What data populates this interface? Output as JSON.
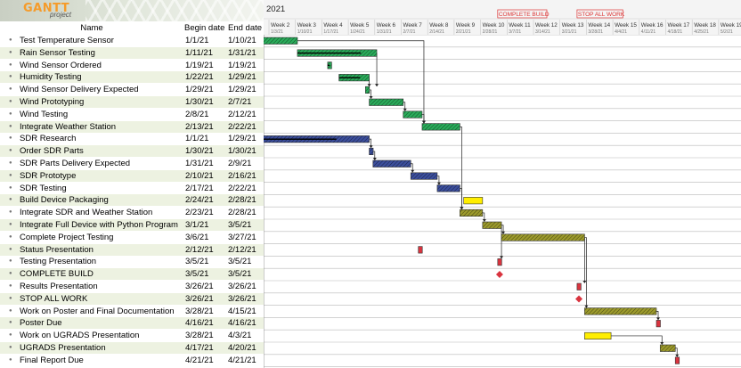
{
  "app": {
    "logo_text": "GANTT",
    "logo_sub": "project"
  },
  "columns": {
    "name": "Name",
    "begin": "Begin date",
    "end": "End date"
  },
  "year": "2021",
  "markers": [
    "COMPLETE BUILD",
    "STOP ALL WORK"
  ],
  "weeks": [
    {
      "label": "Week 2",
      "date": "1/3/21"
    },
    {
      "label": "Week 3",
      "date": "1/10/21"
    },
    {
      "label": "Week 4",
      "date": "1/17/21"
    },
    {
      "label": "Week 5",
      "date": "1/24/21"
    },
    {
      "label": "Week 6",
      "date": "1/31/21"
    },
    {
      "label": "Week 7",
      "date": "2/7/21"
    },
    {
      "label": "Week 8",
      "date": "2/14/21"
    },
    {
      "label": "Week 9",
      "date": "2/21/21"
    },
    {
      "label": "Week 10",
      "date": "2/28/21"
    },
    {
      "label": "Week 11",
      "date": "3/7/21"
    },
    {
      "label": "Week 12",
      "date": "3/14/21"
    },
    {
      "label": "Week 13",
      "date": "3/21/21"
    },
    {
      "label": "Week 14",
      "date": "3/28/21"
    },
    {
      "label": "Week 15",
      "date": "4/4/21"
    },
    {
      "label": "Week 16",
      "date": "4/11/21"
    },
    {
      "label": "Week 17",
      "date": "4/18/21"
    },
    {
      "label": "Week 18",
      "date": "4/25/21"
    },
    {
      "label": "Week 19",
      "date": "5/2/21"
    }
  ],
  "colors": {
    "green": "#2aab5a",
    "blue": "#3b4e9c",
    "olive": "#9c9a2c",
    "yellow": "#ffee00",
    "red": "#d9343f",
    "grid": "#b8b8b8"
  },
  "tasks": [
    {
      "name": "Test Temperature Sensor",
      "begin": "1/1/21",
      "end": "1/10/21",
      "color": "green",
      "type": "task",
      "progress": 1
    },
    {
      "name": "Rain Sensor Testing",
      "begin": "1/11/21",
      "end": "1/31/21",
      "color": "green",
      "type": "task",
      "progress": 0.8
    },
    {
      "name": "Wind Sensor Ordered",
      "begin": "1/19/21",
      "end": "1/19/21",
      "color": "green",
      "type": "task",
      "progress": 0.5
    },
    {
      "name": "Humidity Testing",
      "begin": "1/22/21",
      "end": "1/29/21",
      "color": "green",
      "type": "task",
      "progress": 0.7
    },
    {
      "name": "Wind Sensor Delivery Expected",
      "begin": "1/29/21",
      "end": "1/29/21",
      "color": "green",
      "type": "task",
      "progress": 1
    },
    {
      "name": "Wind Prototyping",
      "begin": "1/30/21",
      "end": "2/7/21",
      "color": "green",
      "type": "task",
      "progress": 1
    },
    {
      "name": "Wind Testing",
      "begin": "2/8/21",
      "end": "2/12/21",
      "color": "green",
      "type": "task",
      "progress": 1
    },
    {
      "name": "Integrate Weather Station",
      "begin": "2/13/21",
      "end": "2/22/21",
      "color": "green",
      "type": "task",
      "progress": 1
    },
    {
      "name": "SDR Research",
      "begin": "1/1/21",
      "end": "1/29/21",
      "color": "blue",
      "type": "task",
      "progress": 0.7
    },
    {
      "name": "Order SDR Parts",
      "begin": "1/30/21",
      "end": "1/30/21",
      "color": "blue",
      "type": "task",
      "progress": 1
    },
    {
      "name": "SDR Parts Delivery Expected",
      "begin": "1/31/21",
      "end": "2/9/21",
      "color": "blue",
      "type": "task",
      "progress": 1
    },
    {
      "name": "SDR Prototype",
      "begin": "2/10/21",
      "end": "2/16/21",
      "color": "blue",
      "type": "task",
      "progress": 1
    },
    {
      "name": "SDR Testing",
      "begin": "2/17/21",
      "end": "2/22/21",
      "color": "blue",
      "type": "task",
      "progress": 1
    },
    {
      "name": "Build Device Packaging",
      "begin": "2/24/21",
      "end": "2/28/21",
      "color": "yellow",
      "type": "task",
      "progress": 0
    },
    {
      "name": "Integrate SDR and Weather Station",
      "begin": "2/23/21",
      "end": "2/28/21",
      "color": "olive",
      "type": "task",
      "progress": 1
    },
    {
      "name": "Integrate Full Device with Python Program",
      "begin": "3/1/21",
      "end": "3/5/21",
      "color": "olive",
      "type": "task",
      "progress": 1
    },
    {
      "name": "Complete Project Testing",
      "begin": "3/6/21",
      "end": "3/27/21",
      "color": "olive",
      "type": "task",
      "progress": 1
    },
    {
      "name": "Status Presentation",
      "begin": "2/12/21",
      "end": "2/12/21",
      "color": "red",
      "type": "task",
      "progress": 1
    },
    {
      "name": "Testing Presentation",
      "begin": "3/5/21",
      "end": "3/5/21",
      "color": "red",
      "type": "task",
      "progress": 1
    },
    {
      "name": "COMPLETE BUILD",
      "begin": "3/5/21",
      "end": "3/5/21",
      "color": "red",
      "type": "milestone",
      "progress": 1
    },
    {
      "name": "Results Presentation",
      "begin": "3/26/21",
      "end": "3/26/21",
      "color": "red",
      "type": "task",
      "progress": 1
    },
    {
      "name": "STOP ALL WORK",
      "begin": "3/26/21",
      "end": "3/26/21",
      "color": "red",
      "type": "milestone",
      "progress": 1
    },
    {
      "name": "Work on Poster and Final Documentation",
      "begin": "3/28/21",
      "end": "4/15/21",
      "color": "olive",
      "type": "task",
      "progress": 1
    },
    {
      "name": "Poster Due",
      "begin": "4/16/21",
      "end": "4/16/21",
      "color": "red",
      "type": "task",
      "progress": 1
    },
    {
      "name": "Work on UGRADS Presentation",
      "begin": "3/28/21",
      "end": "4/3/21",
      "color": "yellow",
      "type": "task",
      "progress": 0
    },
    {
      "name": "UGRADS Presentation",
      "begin": "4/17/21",
      "end": "4/20/21",
      "color": "olive",
      "type": "task",
      "progress": 1
    },
    {
      "name": "Final Report Due",
      "begin": "4/21/21",
      "end": "4/21/21",
      "color": "red",
      "type": "task",
      "progress": 1
    }
  ]
}
